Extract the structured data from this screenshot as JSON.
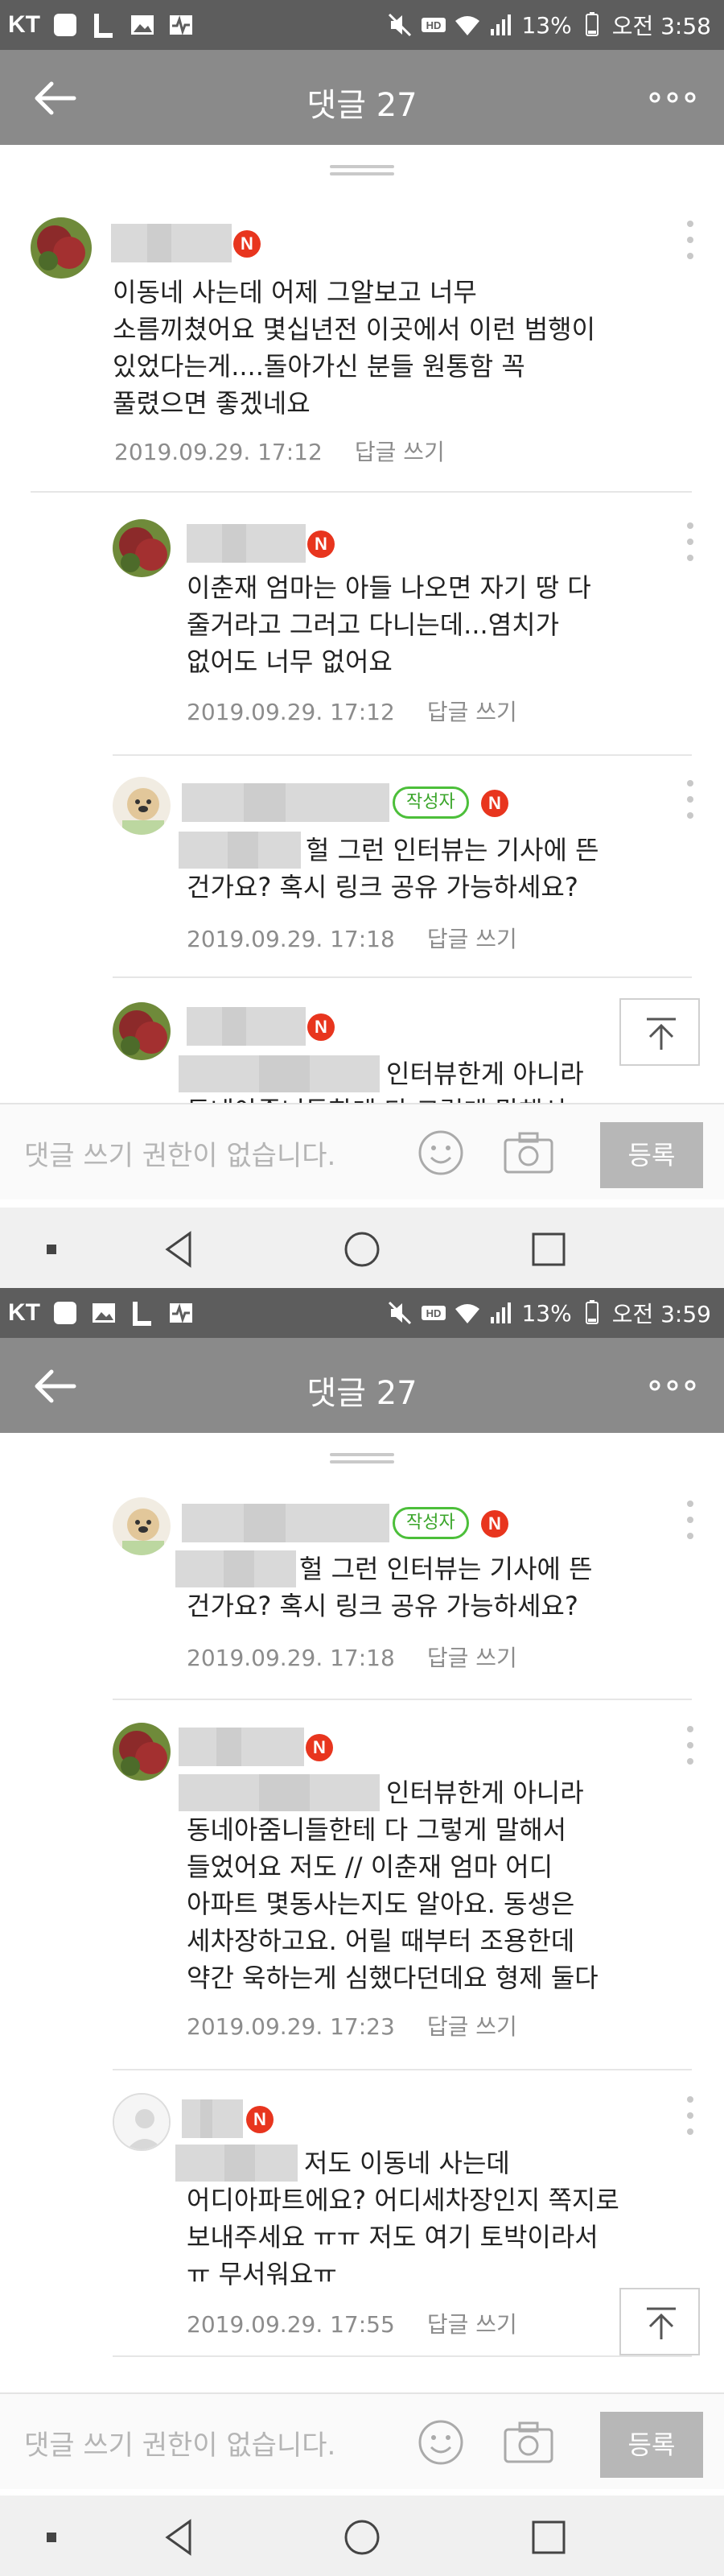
{
  "screens": [
    {
      "status": {
        "carrier": "KT",
        "battery": "13%",
        "time": "오전 3:58"
      },
      "header": {
        "title": "댓글 27"
      },
      "comments": [
        {
          "text": "이동네 사는데 어제 그알보고 너무\n소름끼쳤어요 몇십년전 이곳에서 이런 범행이\n있었다는게....돌아가신 분들 원통함 꼭\n풀렸으면 좋겠네요",
          "date": "2019.09.29. 17:12",
          "reply_label": "답글 쓰기"
        },
        {
          "text": "이춘재 엄마는 아들 나오면 자기 땅 다\n줄거라고 그러고 다니는데...염치가\n없어도 너무 없어요",
          "date": "2019.09.29. 17:12",
          "reply_label": "답글 쓰기"
        },
        {
          "writer_badge": "작성자",
          "text_first": "헐 그런 인터뷰는 기사에 뜬",
          "text_rest": "건가요? 혹시 링크 공유 가능하세요?",
          "date": "2019.09.29. 17:18",
          "reply_label": "답글 쓰기"
        },
        {
          "text_first": "인터뷰한게 아니라",
          "text_rest": "동네아줌니들한테 다 그렇게 말해서"
        }
      ],
      "composer": {
        "placeholder": "댓글 쓰기 권한이 없습니다.",
        "submit": "등록"
      }
    },
    {
      "status": {
        "carrier": "KT",
        "battery": "13%",
        "time": "오전 3:59"
      },
      "header": {
        "title": "댓글 27"
      },
      "comments": [
        {
          "writer_badge": "작성자",
          "text_first": "헐 그런 인터뷰는 기사에 뜬",
          "text_rest": "건가요? 혹시 링크 공유 가능하세요?",
          "date": "2019.09.29. 17:18",
          "reply_label": "답글 쓰기"
        },
        {
          "text_first": "인터뷰한게 아니라",
          "text_rest": "동네아줌니들한테 다 그렇게 말해서\n들었어요 저도 // 이춘재 엄마 어디\n아파트 몇동사는지도 알아요. 동생은\n세차장하고요. 어릴 때부터 조용한데\n약간 욱하는게 심했다던데요 형제 둘다",
          "date": "2019.09.29. 17:23",
          "reply_label": "답글 쓰기"
        },
        {
          "text_first": "저도 이동네 사는데",
          "text_rest": "어디아파트에요? 어디세차장인지 쪽지로\n보내주세요 ㅠㅠ 저도 여기 토박이라서\nㅠ 무서워요ㅠ",
          "date": "2019.09.29. 17:55",
          "reply_label": "답글 쓰기"
        }
      ],
      "composer": {
        "placeholder": "댓글 쓰기 권한이 없습니다.",
        "submit": "등록"
      }
    }
  ],
  "badges": {
    "new": "N"
  },
  "colors": {
    "appbar": "#8a8a8a",
    "statusbar": "#5d5d5d",
    "new_badge": "#e8351e",
    "writer_badge": "#4cbf3a"
  },
  "icons": [
    "back-arrow-icon",
    "more-dots-icon",
    "kebab-icon",
    "scroll-top-icon",
    "emoji-icon",
    "camera-icon",
    "nav-recent-icon",
    "nav-back-icon",
    "nav-home-icon",
    "nav-overview-icon"
  ]
}
